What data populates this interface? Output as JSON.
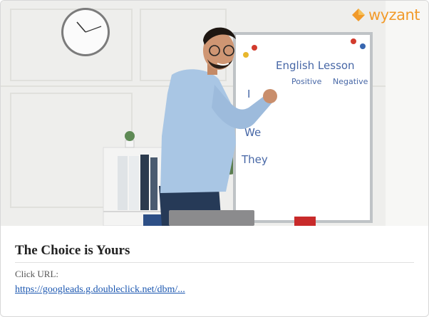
{
  "brand": {
    "logo_text": "wyzant",
    "logo_icon": "wyzant-diamond-icon",
    "accent_color": "#f19a2a"
  },
  "hero": {
    "board_title": "English Lesson",
    "board_col1": "Positive",
    "board_col2": "Negative",
    "board_pronoun1": "I",
    "board_pronoun2": "We",
    "board_pronoun3": "They"
  },
  "ad": {
    "title": "The Choice is Yours",
    "click_label": "Click URL:",
    "click_url": "https://googleads.g.doubleclick.net/dbm/..."
  },
  "colors": {
    "link": "#1a56b0",
    "title": "#222222"
  }
}
